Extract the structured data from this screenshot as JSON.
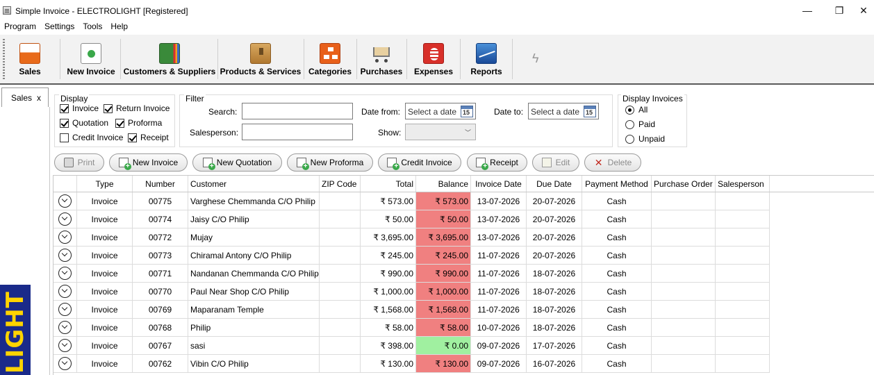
{
  "window": {
    "title": "Simple Invoice - ELECTROLIGHT  [Registered]",
    "minimize": "—",
    "restore": "❐",
    "close": "✕"
  },
  "menu": [
    "Program",
    "Settings",
    "Tools",
    "Help"
  ],
  "ribbon": {
    "items": [
      {
        "label": "Sales",
        "icon": "sales-icon"
      },
      {
        "label": "New Invoice",
        "icon": "new-invoice-icon"
      },
      {
        "label": "Customers & Suppliers",
        "icon": "contacts-book-icon"
      },
      {
        "label": "Products & Services",
        "icon": "product-box-icon"
      },
      {
        "label": "Categories",
        "icon": "categories-icon"
      },
      {
        "label": "Purchases",
        "icon": "shopping-cart-icon"
      },
      {
        "label": "Expenses",
        "icon": "coins-icon"
      },
      {
        "label": "Reports",
        "icon": "chart-icon"
      }
    ]
  },
  "tab": {
    "label": "Sales",
    "close": "x"
  },
  "logo_text": "LIGHT",
  "display": {
    "title": "Display",
    "checks": [
      {
        "label": "Invoice",
        "checked": true
      },
      {
        "label": "Return Invoice",
        "checked": true
      },
      {
        "label": "Quotation",
        "checked": true
      },
      {
        "label": "Proforma",
        "checked": true
      },
      {
        "label": "Credit Invoice",
        "checked": false
      },
      {
        "label": "Receipt",
        "checked": true
      }
    ]
  },
  "filter": {
    "title": "Filter",
    "search_label": "Search:",
    "salesperson_label": "Salesperson:",
    "date_from_label": "Date from:",
    "date_to_label": "Date to:",
    "show_label": "Show:",
    "date_placeholder": "Select a date",
    "calendar_day": "15"
  },
  "display_invoices": {
    "title": "Display Invoices",
    "options": [
      {
        "label": "All",
        "selected": true
      },
      {
        "label": "Paid",
        "selected": false
      },
      {
        "label": "Unpaid",
        "selected": false
      }
    ]
  },
  "actions": {
    "print": "Print",
    "new_invoice": "New Invoice",
    "new_quotation": "New Quotation",
    "new_proforma": "New Proforma",
    "credit_invoice": "Credit Invoice",
    "receipt": "Receipt",
    "edit": "Edit",
    "delete": "Delete"
  },
  "grid": {
    "columns": [
      "",
      "Type",
      "Number",
      "Customer",
      "ZIP Code",
      "Total",
      "Balance",
      "Invoice Date",
      "Due Date",
      "Payment Method",
      "Purchase Order",
      "Salesperson"
    ],
    "rows": [
      {
        "type": "Invoice",
        "number": "00775",
        "customer": "Varghese Chemmanda C/O Philip",
        "zip": "",
        "total": "₹ 573.00",
        "balance": "₹ 573.00",
        "paid": false,
        "invoice_date": "13-07-2026",
        "due_date": "20-07-2026",
        "payment": "Cash",
        "po": "",
        "salesperson": ""
      },
      {
        "type": "Invoice",
        "number": "00774",
        "customer": "Jaisy C/O Philip",
        "zip": "",
        "total": "₹ 50.00",
        "balance": "₹ 50.00",
        "paid": false,
        "invoice_date": "13-07-2026",
        "due_date": "20-07-2026",
        "payment": "Cash",
        "po": "",
        "salesperson": ""
      },
      {
        "type": "Invoice",
        "number": "00772",
        "customer": "Mujay",
        "zip": "",
        "total": "₹ 3,695.00",
        "balance": "₹ 3,695.00",
        "paid": false,
        "invoice_date": "13-07-2026",
        "due_date": "20-07-2026",
        "payment": "Cash",
        "po": "",
        "salesperson": ""
      },
      {
        "type": "Invoice",
        "number": "00773",
        "customer": "Chiramal Antony C/O Philip",
        "zip": "",
        "total": "₹ 245.00",
        "balance": "₹ 245.00",
        "paid": false,
        "invoice_date": "11-07-2026",
        "due_date": "20-07-2026",
        "payment": "Cash",
        "po": "",
        "salesperson": ""
      },
      {
        "type": "Invoice",
        "number": "00771",
        "customer": "Nandanan Chemmanda C/O Philip",
        "zip": "",
        "total": "₹ 990.00",
        "balance": "₹ 990.00",
        "paid": false,
        "invoice_date": "11-07-2026",
        "due_date": "18-07-2026",
        "payment": "Cash",
        "po": "",
        "salesperson": ""
      },
      {
        "type": "Invoice",
        "number": "00770",
        "customer": "Paul Near Shop C/O Philip",
        "zip": "",
        "total": "₹ 1,000.00",
        "balance": "₹ 1,000.00",
        "paid": false,
        "invoice_date": "11-07-2026",
        "due_date": "18-07-2026",
        "payment": "Cash",
        "po": "",
        "salesperson": ""
      },
      {
        "type": "Invoice",
        "number": "00769",
        "customer": "Maparanam Temple",
        "zip": "",
        "total": "₹ 1,568.00",
        "balance": "₹ 1,568.00",
        "paid": false,
        "invoice_date": "11-07-2026",
        "due_date": "18-07-2026",
        "payment": "Cash",
        "po": "",
        "salesperson": ""
      },
      {
        "type": "Invoice",
        "number": "00768",
        "customer": "Philip",
        "zip": "",
        "total": "₹ 58.00",
        "balance": "₹ 58.00",
        "paid": false,
        "invoice_date": "10-07-2026",
        "due_date": "18-07-2026",
        "payment": "Cash",
        "po": "",
        "salesperson": ""
      },
      {
        "type": "Invoice",
        "number": "00767",
        "customer": "sasi",
        "zip": "",
        "total": "₹ 398.00",
        "balance": "₹ 0.00",
        "paid": true,
        "invoice_date": "09-07-2026",
        "due_date": "17-07-2026",
        "payment": "Cash",
        "po": "",
        "salesperson": ""
      },
      {
        "type": "Invoice",
        "number": "00762",
        "customer": "Vibin C/O Philip",
        "zip": "",
        "total": "₹ 130.00",
        "balance": "₹ 130.00",
        "paid": false,
        "invoice_date": "09-07-2026",
        "due_date": "16-07-2026",
        "payment": "Cash",
        "po": "",
        "salesperson": ""
      }
    ]
  },
  "colors": {
    "unpaid_balance": "#f08080",
    "paid_balance": "#a0f0a0"
  }
}
